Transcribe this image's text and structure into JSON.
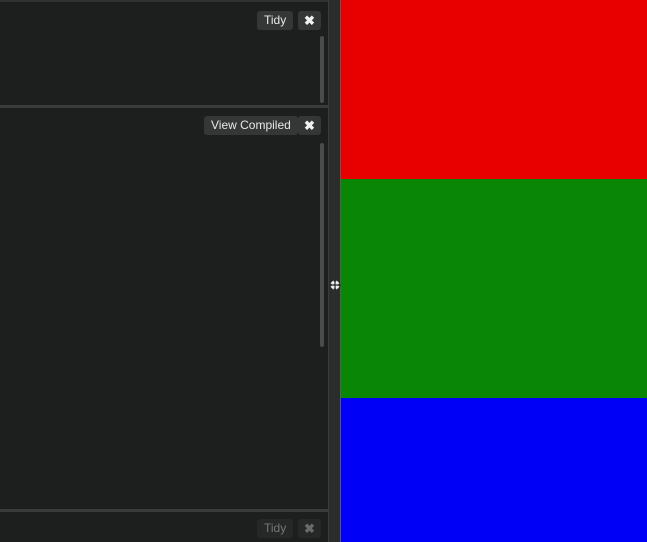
{
  "editors": {
    "top": {
      "tidy_label": "Tidy",
      "close_icon": "✖"
    },
    "middle": {
      "view_compiled_label": "View Compiled",
      "close_icon": "✖"
    },
    "bottom": {
      "tidy_label": "Tidy",
      "close_icon": "✖"
    }
  },
  "resizer": {
    "icon": "move-arrows-icon"
  },
  "result": {
    "bands": [
      {
        "name": "red",
        "color": "#e80000"
      },
      {
        "name": "green",
        "color": "#0a8607"
      },
      {
        "name": "blue",
        "color": "#0000f6"
      }
    ]
  }
}
